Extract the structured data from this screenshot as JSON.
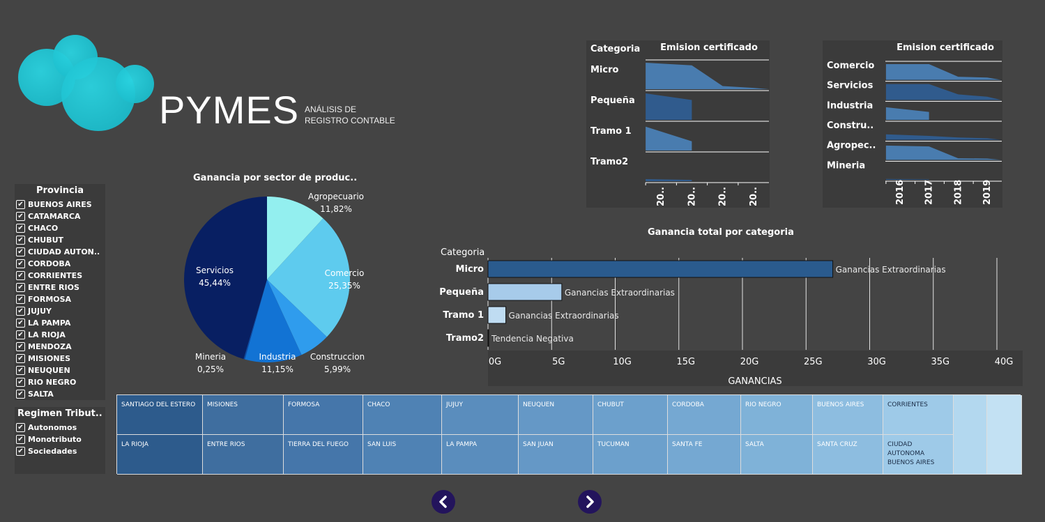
{
  "logo": {
    "title": "PYMES",
    "subtitle_line1": "ANÁLISIS DE",
    "subtitle_line2": "REGISTRO CONTABLE"
  },
  "filters": {
    "provincia": {
      "title": "Provincia",
      "items": [
        "BUENOS AIRES",
        "CATAMARCA",
        "CHACO",
        "CHUBUT",
        "CIUDAD AUTON..",
        "CORDOBA",
        "CORRIENTES",
        "ENTRE RIOS",
        "FORMOSA",
        "JUJUY",
        "LA PAMPA",
        "LA RIOJA",
        "MENDOZA",
        "MISIONES",
        "NEUQUEN",
        "RIO NEGRO",
        "SALTA"
      ]
    },
    "regimen": {
      "title": "Regimen Tribut..",
      "items": [
        "Autonomos",
        "Monotributo",
        "Sociedades"
      ]
    }
  },
  "check_mark": "✔",
  "chart_data": [
    {
      "type": "pie",
      "title": "Ganancia por sector de produc..",
      "slices": [
        {
          "label": "Agropecuario",
          "pct": "11,82%",
          "value": 11.82,
          "color": "#93efef"
        },
        {
          "label": "Comercio",
          "pct": "25,35%",
          "value": 25.35,
          "color": "#5ecbee"
        },
        {
          "label": "Construccion",
          "pct": "5,99%",
          "value": 5.99,
          "color": "#2f9ced"
        },
        {
          "label": "Industria",
          "pct": "11,15%",
          "value": 11.15,
          "color": "#1273d4"
        },
        {
          "label": "Mineria",
          "pct": "0,25%",
          "value": 0.25,
          "color": "#0a4aa8"
        },
        {
          "label": "Servicios",
          "pct": "45,44%",
          "value": 45.44,
          "color": "#081f62"
        }
      ]
    },
    {
      "type": "bar",
      "title": "Ganancia total por categoria",
      "row_header": "Categoria",
      "xlabel": "GANANCIAS",
      "xlim": [
        0,
        40
      ],
      "ticks": [
        "0G",
        "5G",
        "10G",
        "15G",
        "20G",
        "25G",
        "30G",
        "35G",
        "40G"
      ],
      "categories": [
        "Micro",
        "Pequeña",
        "Tramo 1",
        "Tramo2"
      ],
      "values": [
        27.1,
        5.8,
        1.4,
        0.05
      ],
      "labels": [
        "Ganancias Extraordinarias",
        "Ganancias Extraordinarias",
        "Ganancias Extraordinarias",
        "Tendencia Negativa"
      ],
      "colors": [
        "#2a5b8e",
        "#a7cbea",
        "#bfdcf2",
        "#dfeefb"
      ]
    },
    {
      "type": "area",
      "title": "Emision certificado",
      "row_header": "Categoria",
      "categories": [
        "Micro",
        "Pequeña",
        "Tramo 1",
        "Tramo2"
      ],
      "x_ticks": [
        "20..",
        "20..",
        "20..",
        "20.."
      ],
      "series": [
        {
          "name": "Micro",
          "values": [
            1.0,
            0.9,
            0.12,
            0.05
          ]
        },
        {
          "name": "Pequeña",
          "values": [
            1.0,
            0.75
          ]
        },
        {
          "name": "Tramo 1",
          "values": [
            0.9,
            0.35
          ]
        },
        {
          "name": "Tramo2",
          "values": [
            0.08,
            0.05
          ]
        }
      ]
    },
    {
      "type": "area",
      "title": "Emision certificado",
      "categories": [
        "Comercio",
        "Servicios",
        "Industria",
        "Constru..",
        "Agropec..",
        "Mineria"
      ],
      "x_ticks": [
        "2016",
        "2017",
        "2018",
        "2019"
      ],
      "series": [
        {
          "name": "Comercio",
          "values": [
            1.0,
            1.0,
            0.2,
            0.15
          ]
        },
        {
          "name": "Servicios",
          "values": [
            1.0,
            1.0,
            0.35,
            0.2
          ]
        },
        {
          "name": "Industria",
          "values": [
            0.8,
            0.5
          ]
        },
        {
          "name": "Constru..",
          "values": [
            0.35,
            0.25,
            0.15,
            0.1
          ]
        },
        {
          "name": "Agropec..",
          "values": [
            0.9,
            0.85,
            0.1,
            0.08
          ]
        },
        {
          "name": "Mineria",
          "values": [
            0.05,
            0.03
          ]
        }
      ]
    },
    {
      "type": "heatmap",
      "rows": [
        [
          "SANTIAGO DEL ESTERO",
          "MISIONES",
          "FORMOSA",
          "CHACO",
          "JUJUY",
          "NEUQUEN",
          "CHUBUT",
          "CORDOBA",
          "RIO NEGRO",
          "BUENOS AIRES",
          "CORRIENTES",
          "",
          ""
        ],
        [
          "LA RIOJA",
          "ENTRE RIOS",
          "TIERRA DEL FUEGO",
          "SAN LUIS",
          "LA PAMPA",
          "SAN JUAN",
          "TUCUMAN",
          "SANTA FE",
          "SALTA",
          "SANTA CRUZ",
          "CIUDAD AUTONOMA BUENOS AIRES",
          "",
          ""
        ]
      ]
    }
  ],
  "nav": {
    "prev": "‹",
    "next": "›"
  }
}
